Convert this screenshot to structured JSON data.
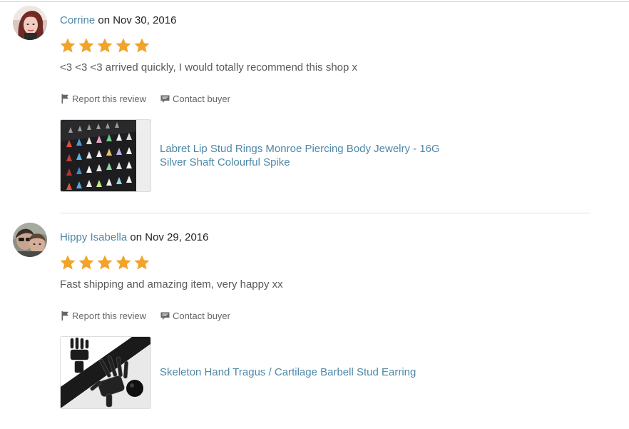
{
  "reviews": [
    {
      "author": "Corrine",
      "date_prefix": " on ",
      "date": "Nov 30, 2016",
      "rating": 5,
      "text": "<3 <3 <3 arrived quickly, I would totally recommend this shop x",
      "report_label": "Report this review",
      "contact_label": "Contact buyer",
      "product_title_line1": "Labret Lip Stud Rings Monroe Piercing Body Jewelry - 16G",
      "product_title_line2": "Silver Shaft Colourful Spike"
    },
    {
      "author": "Hippy Isabella",
      "date_prefix": " on ",
      "date": "Nov 29, 2016",
      "rating": 5,
      "text": "Fast shipping and amazing item, very happy xx",
      "report_label": "Report this review",
      "contact_label": "Contact buyer",
      "product_title_line1": "Skeleton Hand Tragus / Cartilage Barbell Stud Earring",
      "product_title_line2": ""
    }
  ],
  "icons": {
    "star": "star-icon",
    "flag": "flag-icon",
    "message": "speech-bubble-icon"
  },
  "colors": {
    "star": "#f1a32a",
    "link": "#4d88a8",
    "muted_text": "#595959"
  }
}
